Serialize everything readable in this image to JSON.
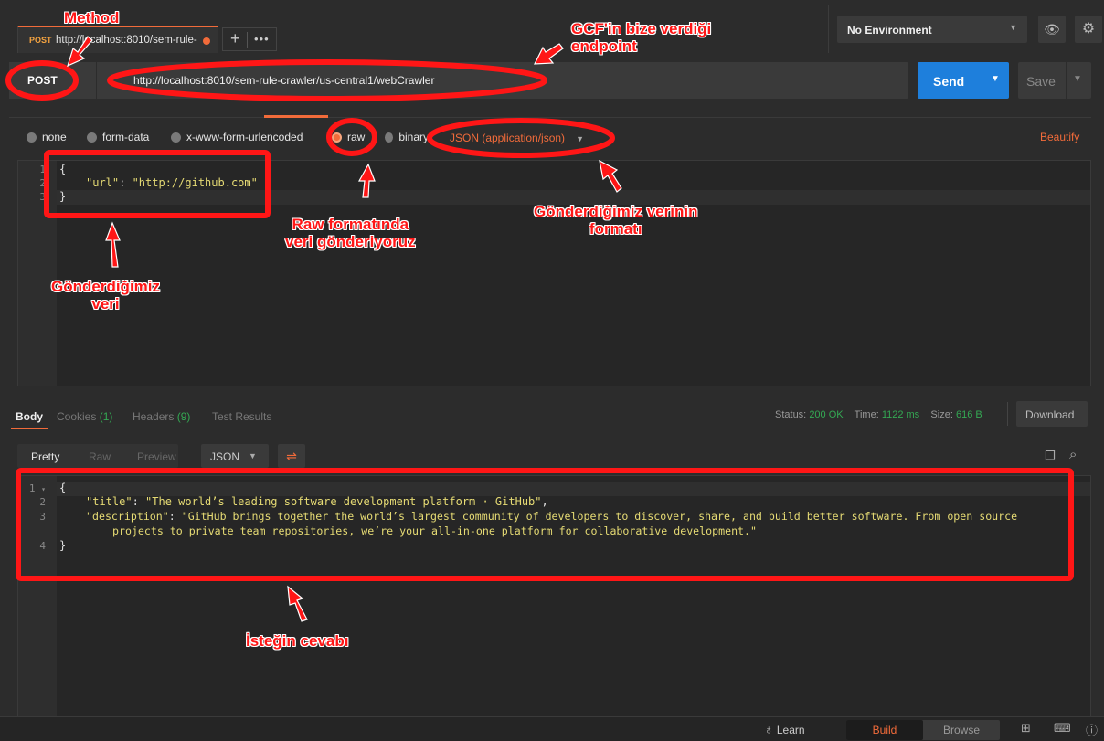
{
  "tab": {
    "method": "POST",
    "url": "http://localhost:8010/sem-rule-"
  },
  "environment": {
    "selected": "No Environment"
  },
  "request": {
    "method": "POST",
    "url": "http://localhost:8010/sem-rule-crawler/us-central1/webCrawler",
    "send_label": "Send",
    "save_label": "Save"
  },
  "body_options": {
    "types": [
      "none",
      "form-data",
      "x-www-form-urlencoded",
      "raw",
      "binary"
    ],
    "selected": "raw",
    "format": "JSON (application/json)",
    "beautify": "Beautify"
  },
  "request_body": {
    "line_numbers": [
      "1",
      "2",
      "3"
    ],
    "line1": "{",
    "key": "\"url\"",
    "sep": ": ",
    "value": "\"http://github.com\"",
    "line3": "}"
  },
  "response_tabs": {
    "body": "Body",
    "cookies": "Cookies",
    "cookies_count": "(1)",
    "headers": "Headers",
    "headers_count": "(9)",
    "tests": "Test Results"
  },
  "status": {
    "status_label": "Status:",
    "status_value": "200 OK",
    "time_label": "Time:",
    "time_value": "1122 ms",
    "size_label": "Size:",
    "size_value": "616 B",
    "download": "Download"
  },
  "view_modes": {
    "pretty": "Pretty",
    "raw": "Raw",
    "preview": "Preview",
    "format": "JSON"
  },
  "response_body": {
    "line_numbers": [
      "1",
      "2",
      "3",
      "4"
    ],
    "line1": "{",
    "title_key": "\"title\"",
    "title_value": "\"The world’s leading software development platform · GitHub\"",
    "desc_key": "\"description\"",
    "desc_value_1": "\"GitHub brings together the world’s largest community of developers to discover, share, and build better software. From open source",
    "desc_value_2": "projects to private team repositories, we’re your all-in-one platform for collaborative development.\"",
    "line4": "}"
  },
  "bottom": {
    "learn": "Learn",
    "build": "Build",
    "browse": "Browse"
  },
  "annotations": {
    "method": "Method",
    "endpoint_1": "GCF'in bize verdiği",
    "endpoint_2": "endpoint",
    "raw_1": "Raw formatında",
    "raw_2": "veri gönderiyoruz",
    "format_1": "Gönderdiğimiz verinin",
    "format_2": "formatı",
    "data_1": "Gönderdiğimiz",
    "data_2": "veri",
    "response": "İsteğin cevabı"
  },
  "colors": {
    "accent": "#f26b3a",
    "send": "#1e7fdc",
    "annotation": "#ff1616",
    "success": "#34a853"
  }
}
